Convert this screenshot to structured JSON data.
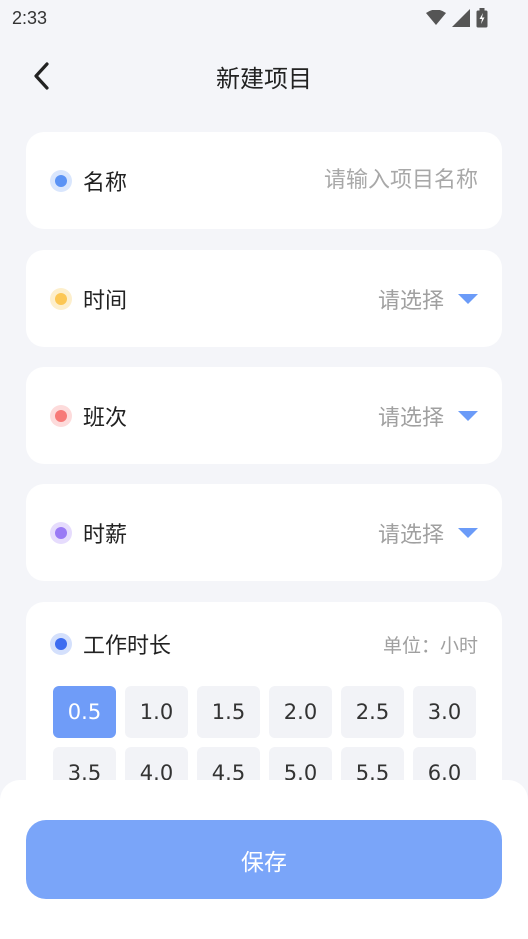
{
  "status_bar": {
    "time": "2:33"
  },
  "header": {
    "title": "新建项目"
  },
  "fields": {
    "name": {
      "label": "名称",
      "placeholder": "请输入项目名称",
      "value": "",
      "color": "#5b93f5"
    },
    "time": {
      "label": "时间",
      "value": "请选择",
      "color": "#fcc754"
    },
    "shift": {
      "label": "班次",
      "value": "请选择",
      "color": "#f77a78"
    },
    "hourly_wage": {
      "label": "时薪",
      "value": "请选择",
      "color": "#9a7af5"
    }
  },
  "work_duration": {
    "label": "工作时长",
    "unit": "单位：小时",
    "color": "#3d6cf0",
    "selected": "0.5",
    "options": [
      "0.5",
      "1.0",
      "1.5",
      "2.0",
      "2.5",
      "3.0",
      "3.5",
      "4.0",
      "4.5",
      "5.0",
      "5.5",
      "6.0"
    ]
  },
  "footer": {
    "save_label": "保存"
  },
  "colors": {
    "accent": "#6f9cf8",
    "caret": "#6b9bf8",
    "background": "#f4f5f9"
  }
}
